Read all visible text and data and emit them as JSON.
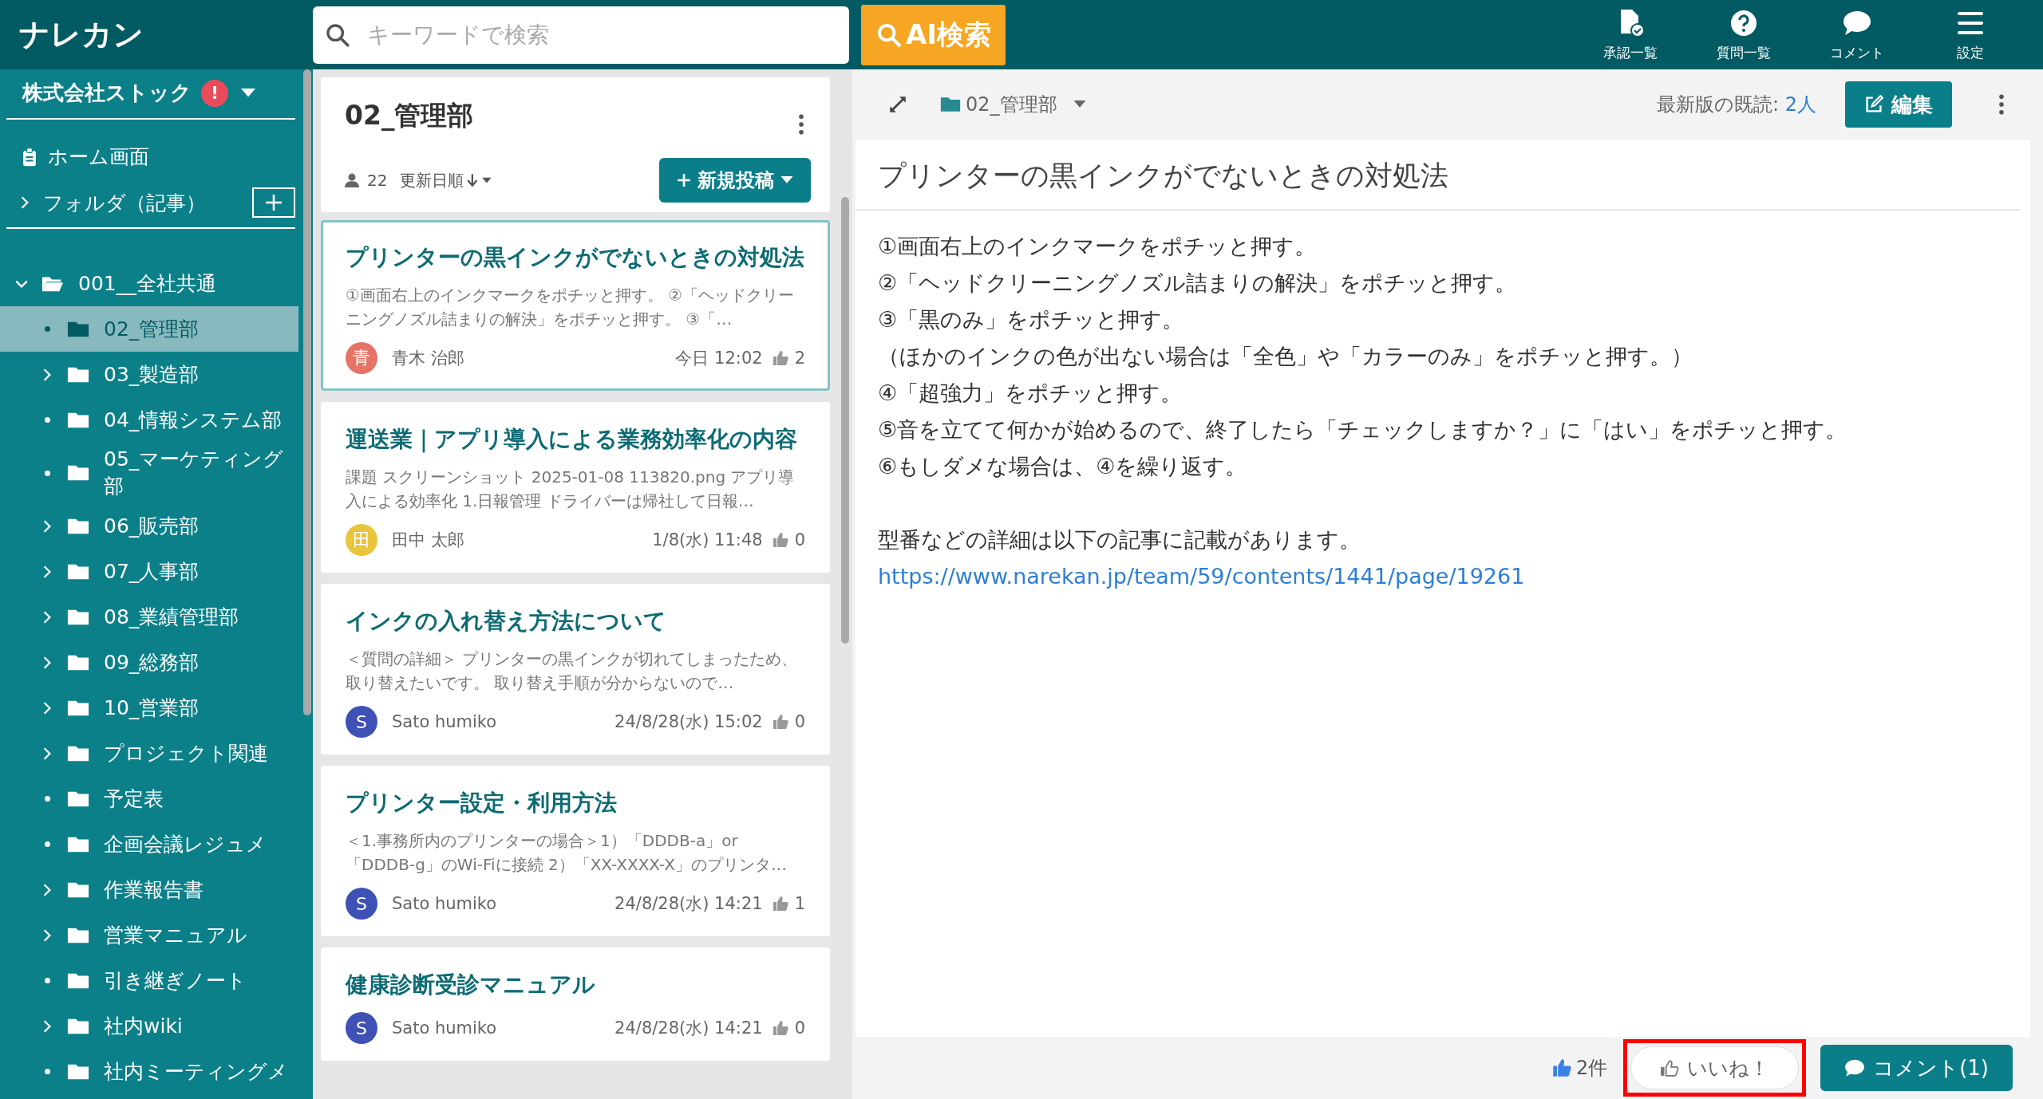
{
  "header": {
    "logo": "ナレカン",
    "search": {
      "placeholder": "キーワードで検索"
    },
    "ai_button": "AI検索",
    "nav": [
      {
        "label": "承認一覧"
      },
      {
        "label": "質問一覧"
      },
      {
        "label": "コメント"
      },
      {
        "label": "設定"
      }
    ]
  },
  "sidebar": {
    "company": "株式会社ストック",
    "alert": "!",
    "home": "ホーム画面",
    "folder_section": "フォルダ（記事）",
    "tree": [
      {
        "label": "001__全社共通",
        "expanded": true,
        "has_children": true,
        "selected": false,
        "children": [
          {
            "label": "02_管理部",
            "has_children": false,
            "selected": true
          },
          {
            "label": "03_製造部",
            "has_children": true,
            "selected": false
          },
          {
            "label": "04_情報システム部",
            "has_children": false,
            "selected": false
          },
          {
            "label": "05_マーケティング部",
            "has_children": false,
            "selected": false
          },
          {
            "label": "06_販売部",
            "has_children": true,
            "selected": false
          },
          {
            "label": "07_人事部",
            "has_children": true,
            "selected": false
          },
          {
            "label": "08_業績管理部",
            "has_children": true,
            "selected": false
          },
          {
            "label": "09_総務部",
            "has_children": true,
            "selected": false
          },
          {
            "label": "10_営業部",
            "has_children": true,
            "selected": false
          },
          {
            "label": "プロジェクト関連",
            "has_children": true,
            "selected": false
          },
          {
            "label": "予定表",
            "has_children": false,
            "selected": false
          },
          {
            "label": "企画会議レジュメ",
            "has_children": false,
            "selected": false
          },
          {
            "label": "作業報告書",
            "has_children": true,
            "selected": false
          },
          {
            "label": "営業マニュアル",
            "has_children": true,
            "selected": false
          },
          {
            "label": "引き継ぎノート",
            "has_children": false,
            "selected": false
          },
          {
            "label": "社内wiki",
            "has_children": true,
            "selected": false
          },
          {
            "label": "社内ミーティングメ",
            "has_children": false,
            "selected": false
          }
        ]
      }
    ]
  },
  "list": {
    "folder": "02_管理部",
    "members": "22",
    "sort": "更新日順",
    "new_button": "新規投稿",
    "posts": [
      {
        "title": "プリンターの黒インクがでないときの対処法",
        "excerpt": "①画面右上のインクマークをポチッと押す。 ②「ヘッドクリーニングノズル詰まりの解決」をポチッと押す。 ③「…",
        "avatar": "青",
        "color": "#e57366",
        "author": "青木 治郎",
        "date": "今日 12:02",
        "likes": "2",
        "selected": true
      },
      {
        "title": "運送業｜アプリ導入による業務効率化の内容",
        "excerpt": "課題 スクリーンショット 2025-01-08 113820.png アプリ導入による効率化 1.日報管理 ドライバーは帰社して日報…",
        "avatar": "田",
        "color": "#e8c53a",
        "author": "田中 太郎",
        "date": "1/8(水) 11:48",
        "likes": "0",
        "selected": false
      },
      {
        "title": "インクの入れ替え方法について",
        "excerpt": "＜質問の詳細＞ プリンターの黒インクが切れてしまったため、取り替えたいです。 取り替え手順が分からないので…",
        "avatar": "S",
        "color": "#3f51b5",
        "author": "Sato humiko",
        "date": "24/8/28(水) 15:02",
        "likes": "0",
        "selected": false
      },
      {
        "title": "プリンター設定・利用方法",
        "excerpt": "＜1.事務所内のプリンターの場合＞1）「DDDB-a」or「DDDB-g」のWi-Fiに接続 2）「XX-XXXX-X」のプリンタ…",
        "avatar": "S",
        "color": "#3f51b5",
        "author": "Sato humiko",
        "date": "24/8/28(水) 14:21",
        "likes": "1",
        "selected": false
      },
      {
        "title": "健康診断受診マニュアル",
        "avatar": "S",
        "color": "#3f51b5",
        "author": "Sato humiko",
        "date": "24/8/28(水) 14:21",
        "likes": "0",
        "selected": false
      }
    ]
  },
  "article": {
    "folder": "02_管理部",
    "read_label": "最新版の既読: ",
    "read_count": "2人",
    "edit_button": "編集",
    "title": "プリンターの黒インクがでないときの対処法",
    "lines": [
      "①画面右上のインクマークをポチッと押す。",
      "②「ヘッドクリーニングノズル詰まりの解決」をポチッと押す。",
      "③「黒のみ」をポチッと押す。",
      "（ほかのインクの色が出ない場合は「全色」や「カラーのみ」をポチッと押す。）",
      "④「超強力」をポチッと押す。",
      "⑤音を立てて何かが始めるので、終了したら「チェックしますか？」に「はい」をポチッと押す。",
      "⑥もしダメな場合は、④を繰り返す。"
    ],
    "note": "型番などの詳細は以下の記事に記載があります。",
    "link": "https://www.narekan.jp/team/59/contents/1441/page/19261",
    "like_count": "2件",
    "like_button": "いいね！",
    "like_highlighted": true,
    "comment_button": "コメント(1)"
  }
}
